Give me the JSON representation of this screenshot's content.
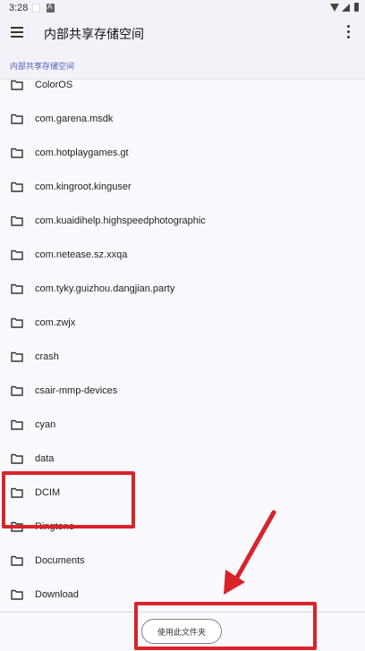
{
  "status_bar": {
    "time": "3:28"
  },
  "app_bar": {
    "title": "内部共享存储空间"
  },
  "breadcrumb": "内部共享存储空间",
  "folders": [
    {
      "label": "ColorOS"
    },
    {
      "label": "com.garena.msdk"
    },
    {
      "label": "com.hotplaygames.gt"
    },
    {
      "label": "com.kingroot.kinguser"
    },
    {
      "label": "com.kuaidihelp.highspeedphotographic"
    },
    {
      "label": "com.netease.sz.xxqa"
    },
    {
      "label": "com.tyky.guizhou.dangjian.party"
    },
    {
      "label": "com.zwjx"
    },
    {
      "label": "crash"
    },
    {
      "label": "csair-mmp-devices"
    },
    {
      "label": "cyan"
    },
    {
      "label": "data"
    },
    {
      "label": "DCIM"
    },
    {
      "label": "Ringtone"
    },
    {
      "label": "Documents"
    },
    {
      "label": "Download"
    }
  ],
  "bottom": {
    "use_folder_label": "使用此文件夹"
  },
  "icons": {
    "menu": "menu-icon",
    "more": "more-vert-icon",
    "folder": "folder-icon"
  },
  "colors": {
    "annotation": "#d8232a",
    "breadcrumb": "#4f5dbb",
    "background": "#fafafe"
  }
}
